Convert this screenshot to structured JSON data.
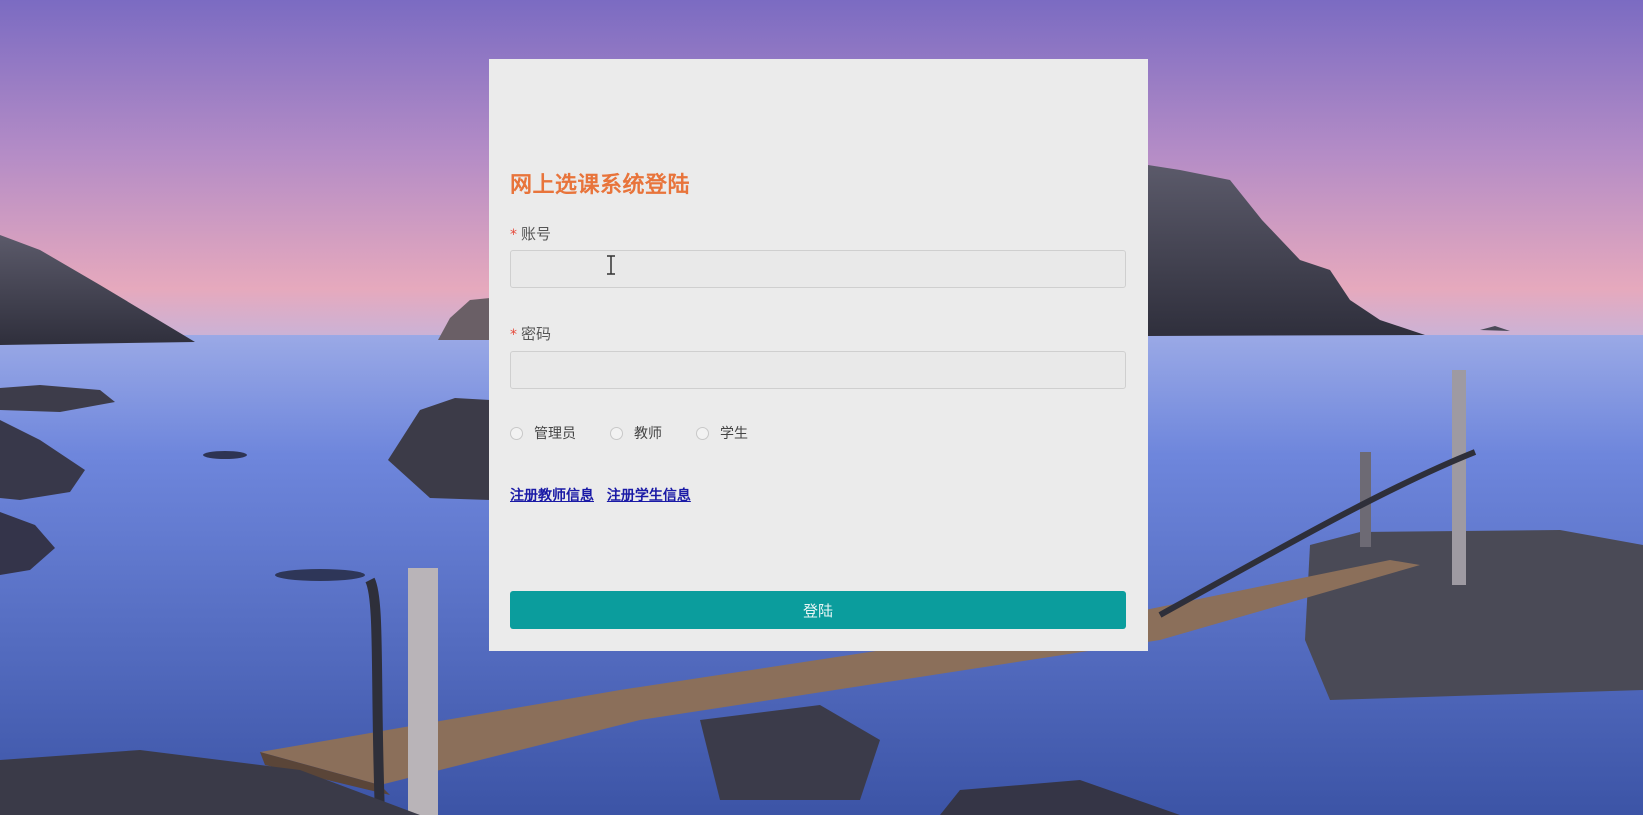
{
  "login": {
    "title": "网上选课系统登陆",
    "account_label": "账号",
    "password_label": "密码",
    "required_mark": "*",
    "account_value": "",
    "password_value": "",
    "roles": [
      "管理员",
      "教师",
      "学生"
    ],
    "links": {
      "register_teacher": "注册教师信息",
      "register_student": "注册学生信息"
    },
    "submit_label": "登陆"
  },
  "colors": {
    "title": "#e8743b",
    "submit_bg": "#0b9d9d",
    "link": "#1a1aa6",
    "card_bg": "#ebebeb"
  }
}
